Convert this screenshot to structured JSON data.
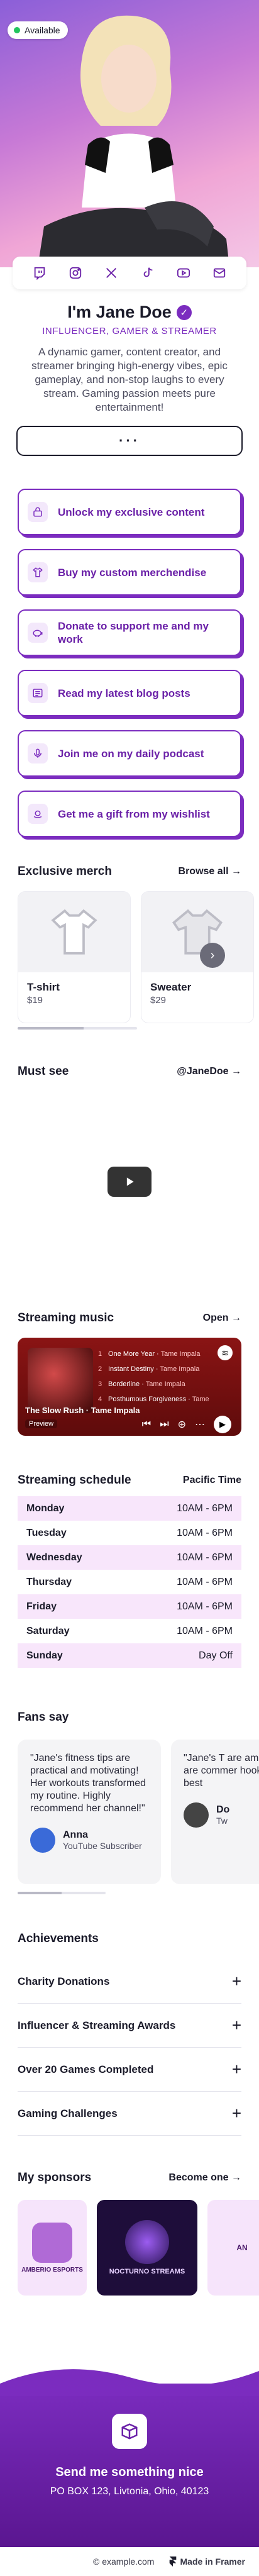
{
  "hero": {
    "available_label": "Available"
  },
  "social": [
    "twitch-icon",
    "instagram-icon",
    "x-icon",
    "tiktok-icon",
    "youtube-icon",
    "mail-icon"
  ],
  "profile": {
    "name": "I'm Jane Doe",
    "tagline": "INFLUENCER, GAMER & STREAMER",
    "bio": "A dynamic gamer, content creator, and streamer bringing high-energy vibes, epic gameplay, and non-stop laughs to every stream. Gaming passion meets pure entertainment!",
    "more_label": "···"
  },
  "links": [
    {
      "label": "Unlock my exclusive content",
      "icon": "lock-icon"
    },
    {
      "label": "Buy my custom merchendise",
      "icon": "shirt-icon"
    },
    {
      "label": "Donate to support me and my work",
      "icon": "piggy-bank-icon"
    },
    {
      "label": "Read my latest blog posts",
      "icon": "blog-icon"
    },
    {
      "label": "Join me on my daily podcast",
      "icon": "microphone-icon"
    },
    {
      "label": "Get me a gift from my wishlist",
      "icon": "amazon-icon"
    }
  ],
  "merch": {
    "title": "Exclusive merch",
    "link": "Browse all →",
    "items": [
      {
        "name": "T-shirt",
        "price": "$19"
      },
      {
        "name": "Sweater",
        "price": "$29"
      }
    ]
  },
  "must_see": {
    "title": "Must see",
    "link": "@JaneDoe →"
  },
  "music": {
    "title": "Streaming music",
    "link": "Open →",
    "tracks": [
      {
        "num": "1",
        "title": "One More Year",
        "artist": "Tame Impala"
      },
      {
        "num": "2",
        "title": "Instant Destiny",
        "artist": "Tame Impala"
      },
      {
        "num": "3",
        "title": "Borderline",
        "artist": "Tame Impala"
      },
      {
        "num": "4",
        "title": "Posthumous Forgiveness",
        "artist": "Tame"
      }
    ],
    "now_playing": "The Slow Rush · Tame Impala",
    "preview": "Preview"
  },
  "schedule": {
    "title": "Streaming schedule",
    "timezone": "Pacific Time",
    "rows": [
      {
        "day": "Monday",
        "hours": "10AM - 6PM"
      },
      {
        "day": "Tuesday",
        "hours": "10AM - 6PM"
      },
      {
        "day": "Wednesday",
        "hours": "10AM - 6PM"
      },
      {
        "day": "Thursday",
        "hours": "10AM - 6PM"
      },
      {
        "day": "Friday",
        "hours": "10AM - 6PM"
      },
      {
        "day": "Saturday",
        "hours": "10AM - 6PM"
      },
      {
        "day": "Sunday",
        "hours": "Day Off"
      }
    ]
  },
  "fans": {
    "title": "Fans say",
    "items": [
      {
        "quote": "\"Jane's fitness tips are practical and motivating! Her workouts transformed my routine. Highly recommend her channel!\"",
        "name": "Anna",
        "role": "YouTube Subscriber"
      },
      {
        "quote": "\"Jane's T are amazi skills are commer hooked o the best",
        "name": "Do",
        "role": "Tw"
      }
    ]
  },
  "achievements": {
    "title": "Achievements",
    "items": [
      "Charity Donations",
      "Influencer & Streaming Awards",
      "Over 20 Games Completed",
      "Gaming Challenges"
    ]
  },
  "sponsors": {
    "title": "My sponsors",
    "link": "Become one →",
    "items": [
      {
        "label": "AMBERIO ESPORTS"
      },
      {
        "label": "NOCTURNO STREAMS"
      },
      {
        "label": "AN"
      }
    ]
  },
  "footer": {
    "title": "Send me something nice",
    "address": "PO BOX 123, Livtonia, Ohio, 40123"
  },
  "bottom": {
    "copyright": "© example.com",
    "framer": "Made in Framer"
  },
  "colors": {
    "accent": "#7b2cbf",
    "accent_dark": "#6b21a8",
    "highlight_row": "#f8e6fb"
  }
}
